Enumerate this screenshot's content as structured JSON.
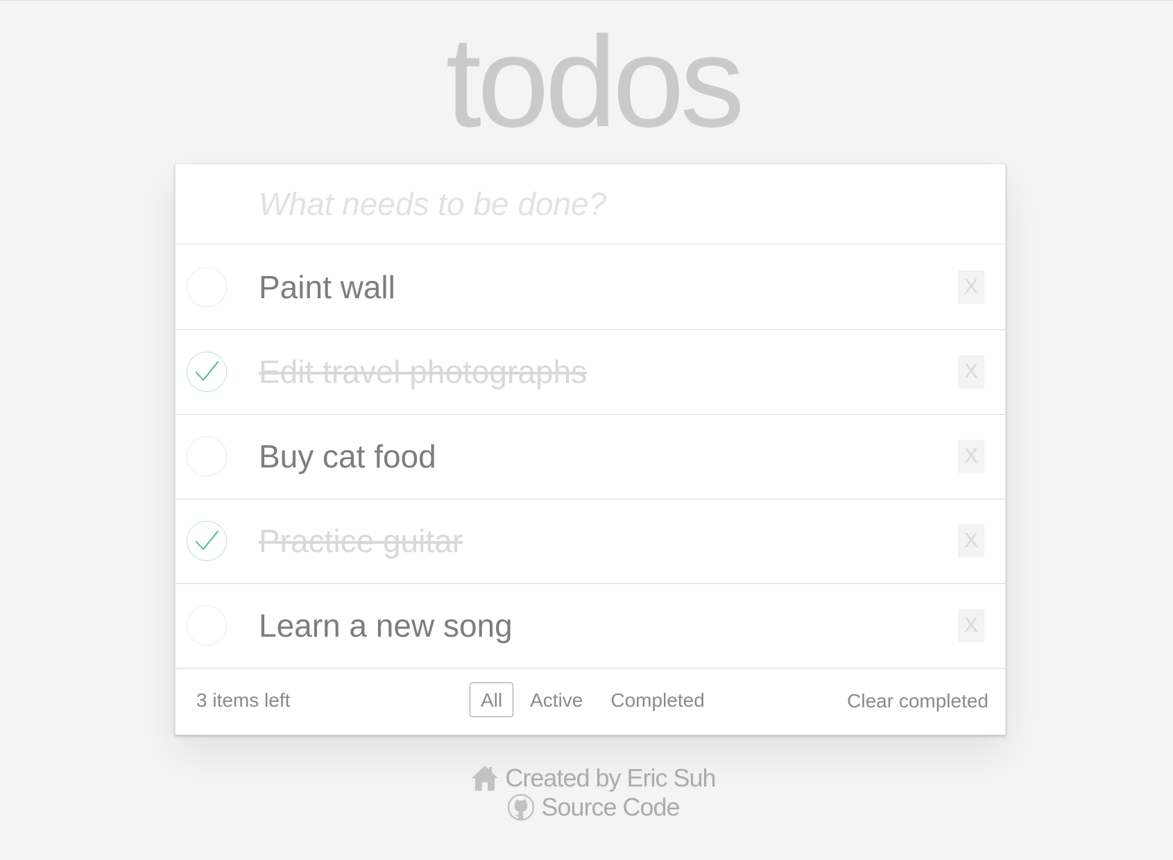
{
  "app": {
    "title": "todos"
  },
  "new_todo": {
    "placeholder": "What needs to be done?",
    "value": ""
  },
  "todos": [
    {
      "label": "Paint wall",
      "completed": false,
      "destroy_label": "X"
    },
    {
      "label": "Edit travel photographs",
      "completed": true,
      "destroy_label": "X"
    },
    {
      "label": "Buy cat food",
      "completed": false,
      "destroy_label": "X"
    },
    {
      "label": "Practice guitar",
      "completed": true,
      "destroy_label": "X"
    },
    {
      "label": "Learn a new song",
      "completed": false,
      "destroy_label": "X"
    }
  ],
  "footer": {
    "items_left": "3 items left",
    "filters": [
      {
        "label": "All",
        "selected": true
      },
      {
        "label": "Active",
        "selected": false
      },
      {
        "label": "Completed",
        "selected": false
      }
    ],
    "clear_completed": "Clear completed"
  },
  "credits": {
    "author_icon": "home-icon",
    "author": "Created by Eric Suh",
    "source_icon": "github-icon",
    "source": "Source Code"
  },
  "colors": {
    "background": "#f4f4f4",
    "title": "#c8c8c8",
    "check": "#5dc2a5",
    "check_ring": "#bfe2d9",
    "completed_text": "#d9d9d9",
    "active_text": "#7d7d7d"
  }
}
